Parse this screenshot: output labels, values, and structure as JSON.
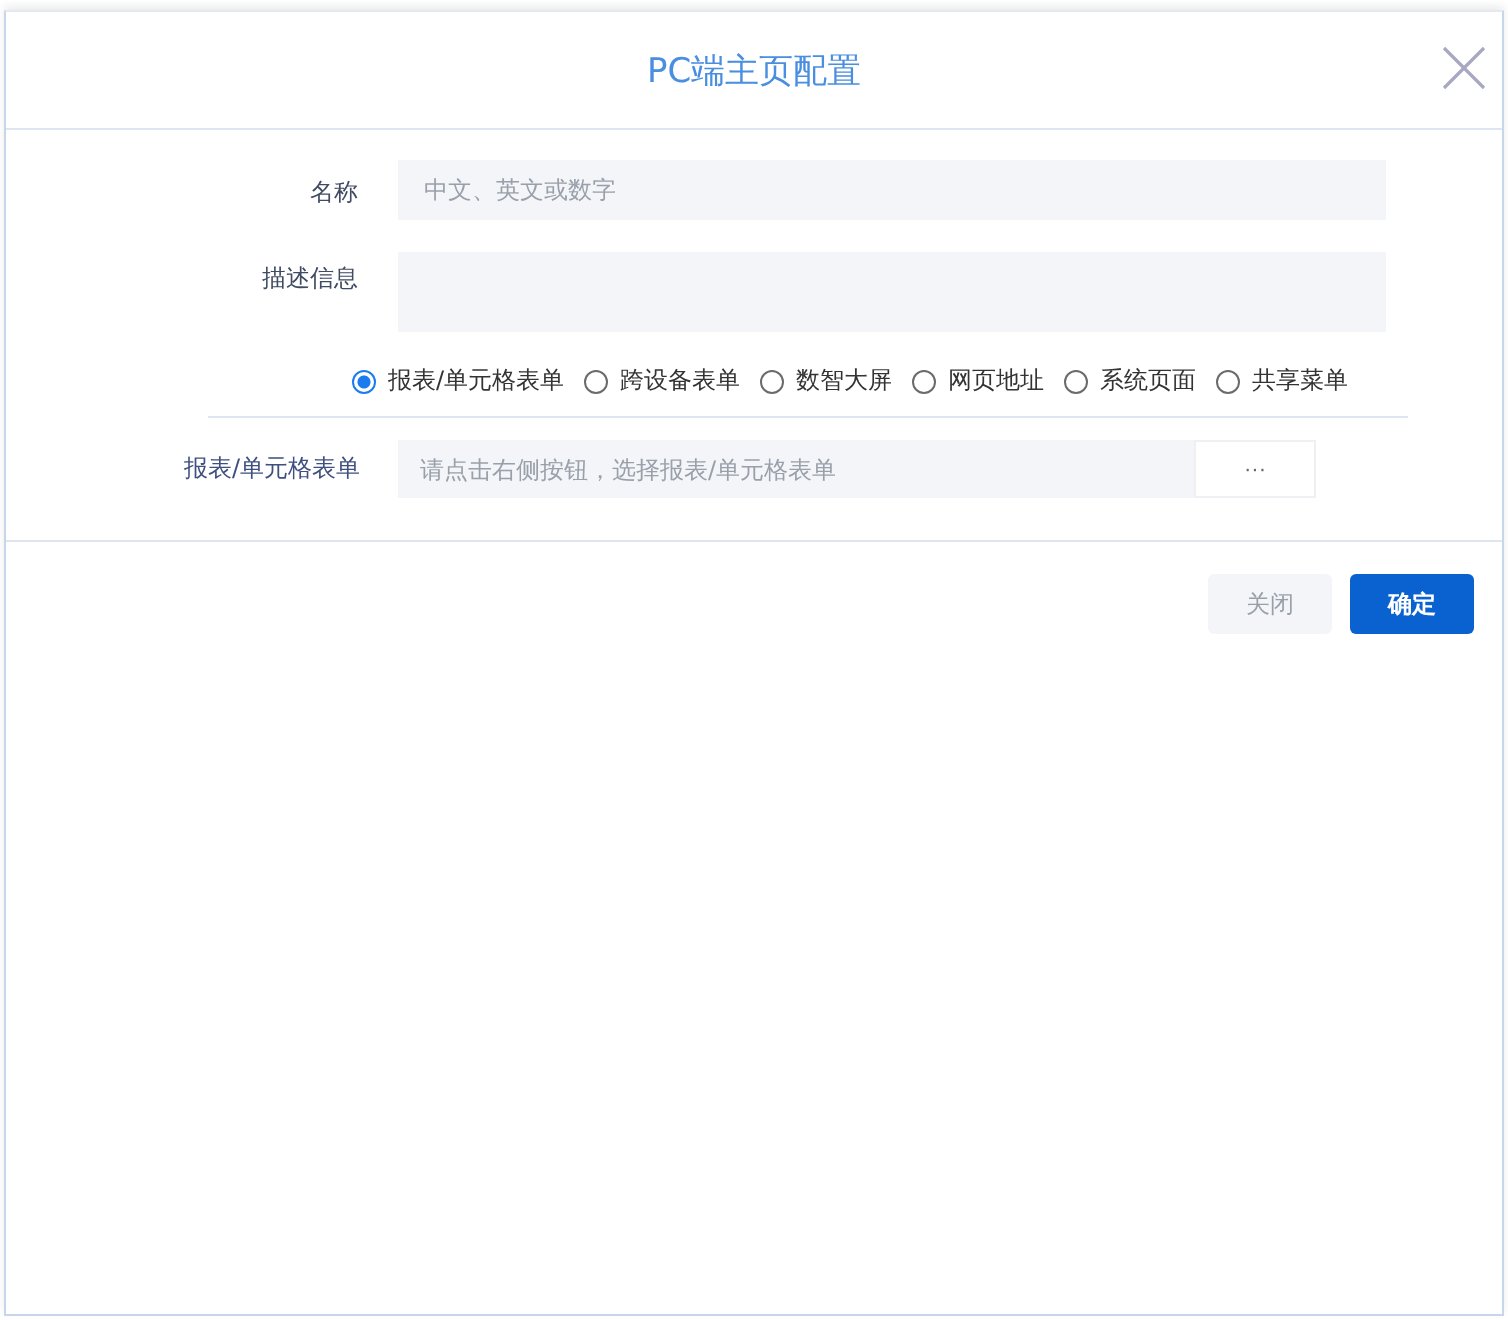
{
  "dialog": {
    "title": "PC端主页配置"
  },
  "fields": [
    {
      "label": "名称",
      "placeholder": "中文、英文或数字",
      "kind": "input"
    },
    {
      "label": "描述信息",
      "kind": "textarea"
    }
  ],
  "types": [
    {
      "label": "报表/单元格表单",
      "selected": true
    },
    {
      "label": "跨设备表单",
      "selected": false
    },
    {
      "label": "数智大屏",
      "selected": false
    },
    {
      "label": "网页地址",
      "selected": false
    },
    {
      "label": "系统页面",
      "selected": false
    },
    {
      "label": "共享菜单",
      "selected": false
    }
  ],
  "picker": {
    "label": "报表/单元格表单",
    "placeholder": "请点击右侧按钮，选择报表/单元格表单",
    "button": "···"
  },
  "buttons": [
    {
      "label": "关闭",
      "kind": "secondary"
    },
    {
      "label": "确定",
      "kind": "primary"
    }
  ]
}
